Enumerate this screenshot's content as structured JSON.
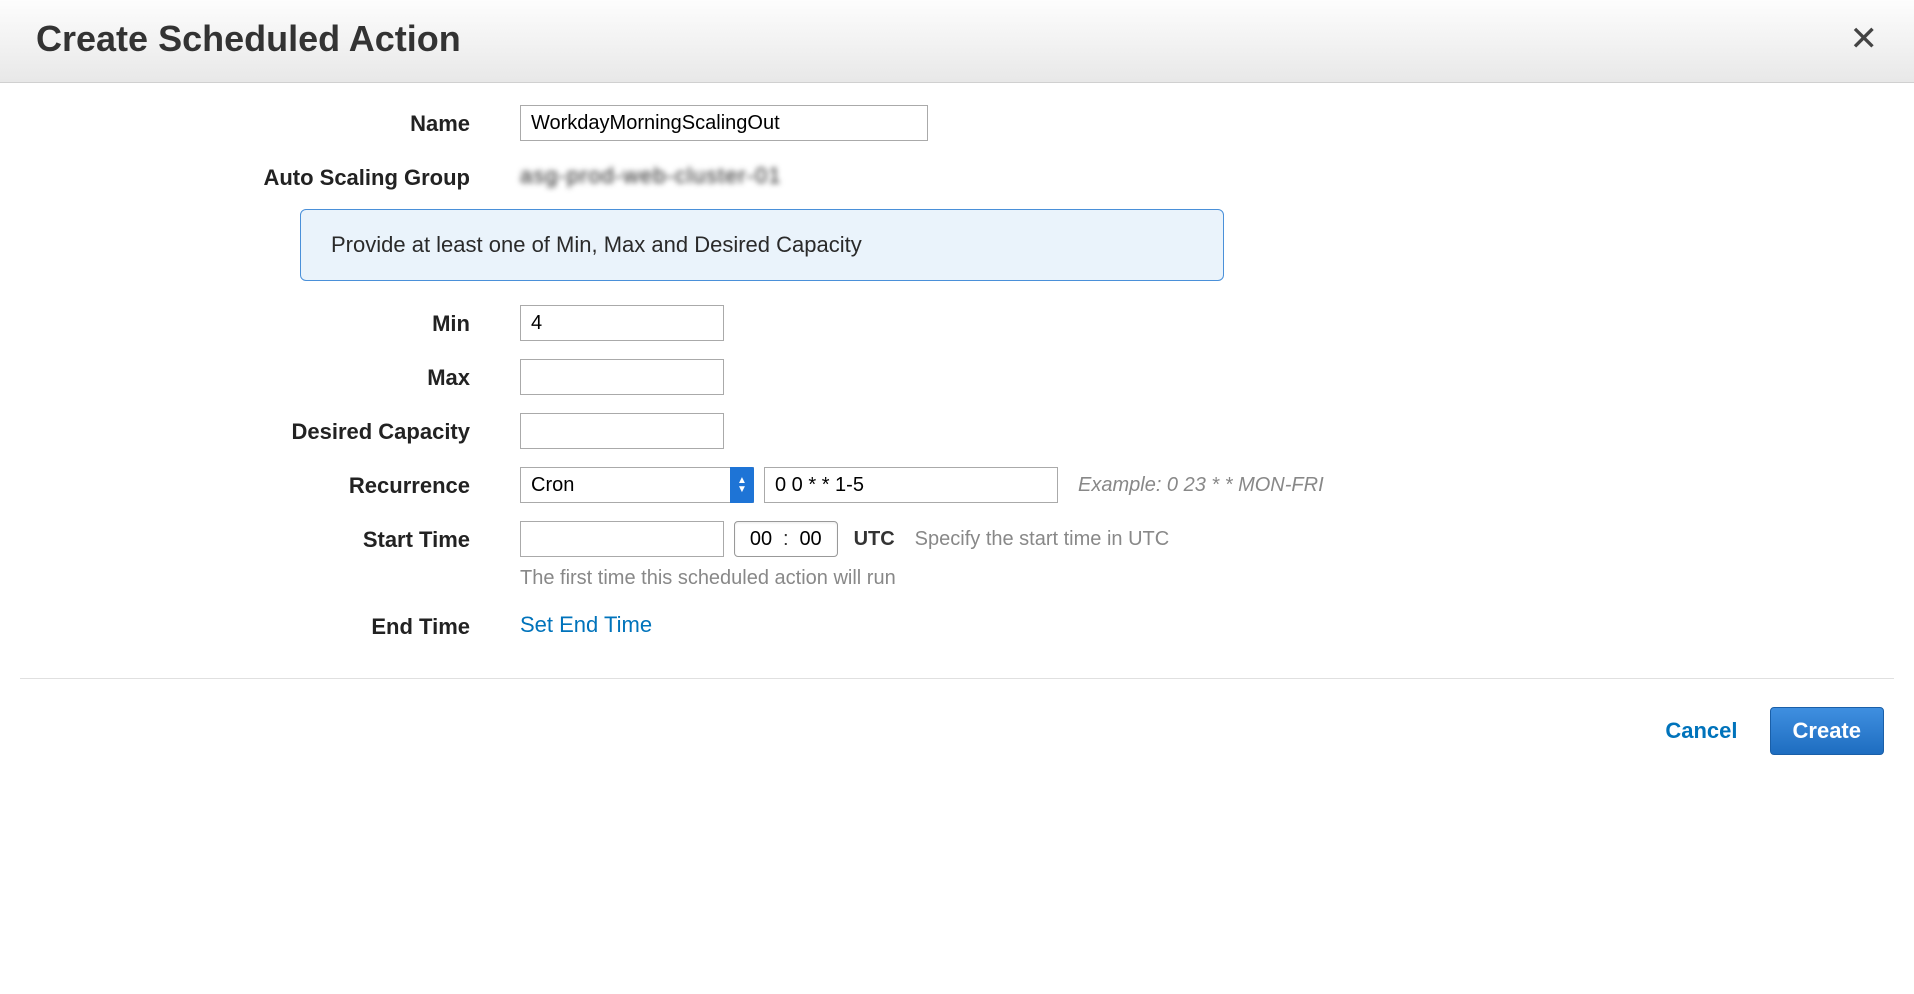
{
  "dialog": {
    "title": "Create Scheduled Action"
  },
  "form": {
    "name": {
      "label": "Name",
      "value": "WorkdayMorningScalingOut"
    },
    "auto_scaling_group": {
      "label": "Auto Scaling Group",
      "value": "asg-prod-web-cluster-01"
    },
    "info_message": "Provide at least one of Min, Max and Desired Capacity",
    "min": {
      "label": "Min",
      "value": "4"
    },
    "max": {
      "label": "Max",
      "value": ""
    },
    "desired": {
      "label": "Desired Capacity",
      "value": ""
    },
    "recurrence": {
      "label": "Recurrence",
      "selected": "Cron",
      "cron_value": "0 0 * * 1-5",
      "example": "Example: 0 23 * * MON-FRI"
    },
    "start_time": {
      "label": "Start Time",
      "date_value": "",
      "hour": "00",
      "minute": "00",
      "tz": "UTC",
      "helper_inline": "Specify the start time in UTC",
      "helper_below": "The first time this scheduled action will run"
    },
    "end_time": {
      "label": "End Time",
      "action": "Set End Time"
    }
  },
  "footer": {
    "cancel": "Cancel",
    "create": "Create"
  }
}
